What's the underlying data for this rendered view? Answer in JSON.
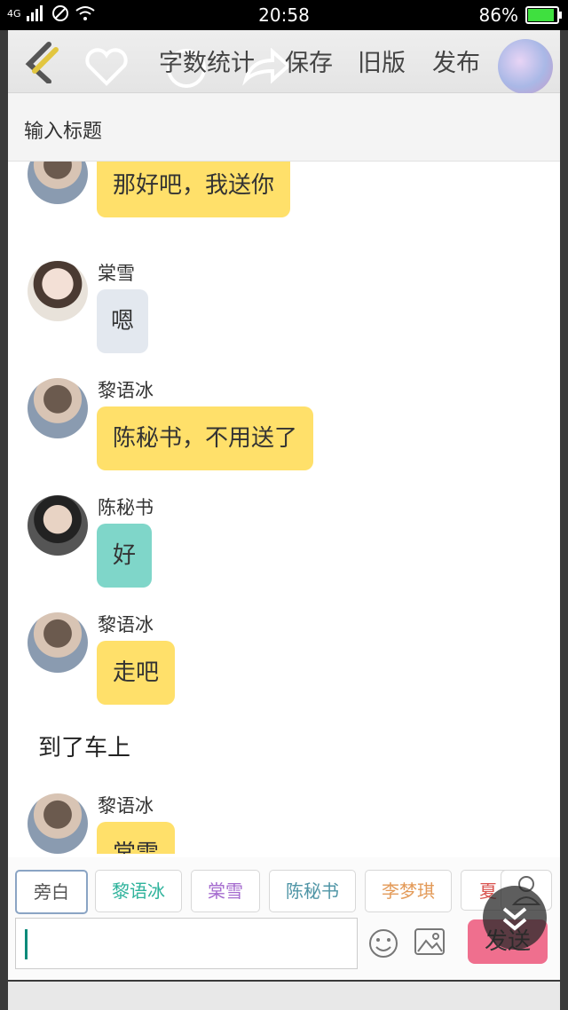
{
  "status": {
    "time": "20:58",
    "battery": "86%",
    "network": "4G"
  },
  "toolbar": {
    "stats_label": "字数统计",
    "save_label": "保存",
    "old_label": "旧版",
    "publish_label": "发布"
  },
  "title_input": {
    "placeholder": "输入标题"
  },
  "messages": [
    {
      "speaker": "",
      "text": "那好吧，我送你"
    },
    {
      "speaker": "棠雪",
      "text": "嗯"
    },
    {
      "speaker": "黎语冰",
      "text": "陈秘书，不用送了"
    },
    {
      "speaker": "陈秘书",
      "text": "好"
    },
    {
      "speaker": "黎语冰",
      "text": "走吧"
    },
    {
      "narration": "到了车上"
    },
    {
      "speaker": "黎语冰",
      "text": "棠雪"
    }
  ],
  "roles": [
    {
      "label": "旁白",
      "color": "#555555"
    },
    {
      "label": "黎语冰",
      "color": "#2fb39c"
    },
    {
      "label": "棠雪",
      "color": "#a56ccf"
    },
    {
      "label": "陈秘书",
      "color": "#4f95a6"
    },
    {
      "label": "李梦琪",
      "color": "#e39a58"
    },
    {
      "label": "夏",
      "color": "#d9534f"
    }
  ],
  "composer": {
    "send_label": "发送"
  },
  "colors": {
    "bubble_yellow": "#ffe06a",
    "bubble_teal": "#7fd6c9",
    "send": "#ef6f8e"
  }
}
